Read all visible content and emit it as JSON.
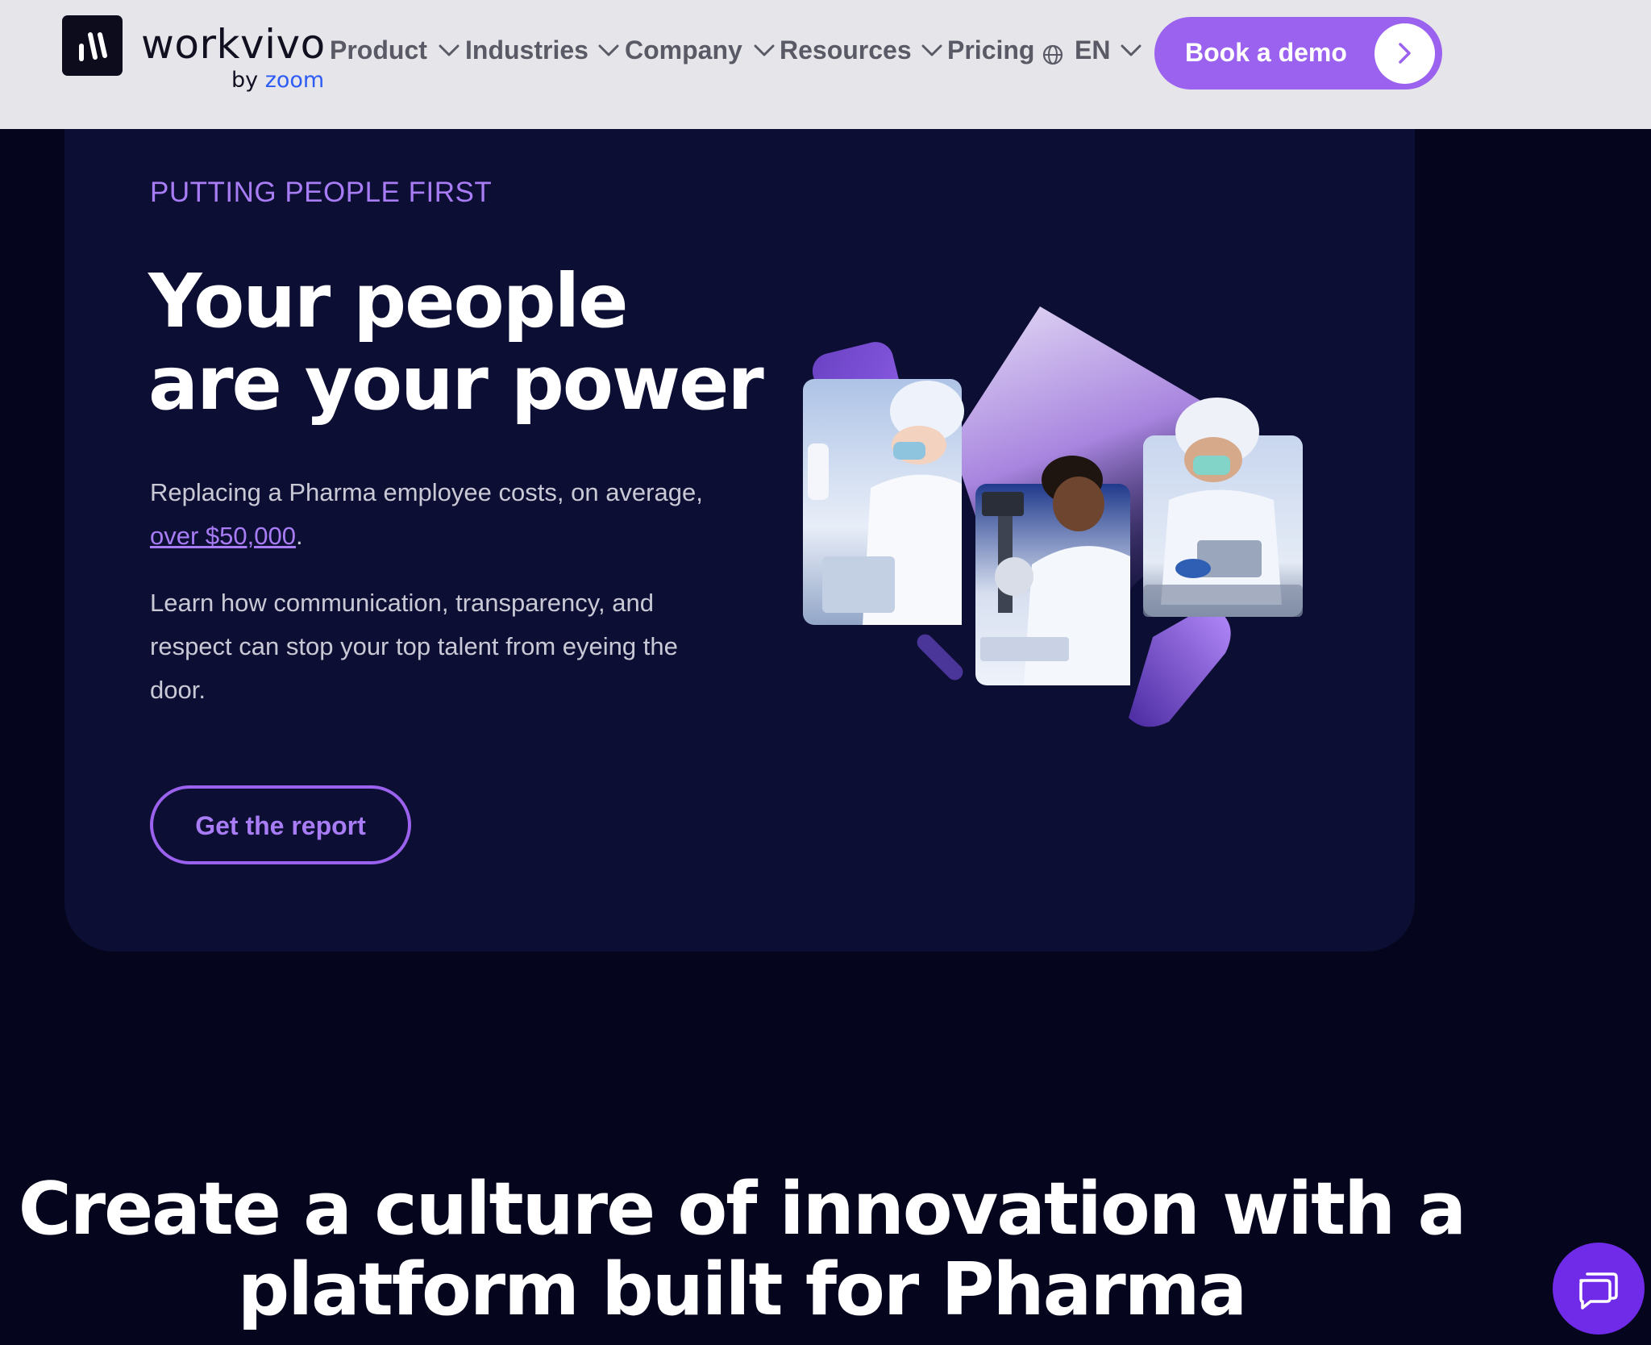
{
  "header": {
    "brand": {
      "name": "workvivo",
      "by": "by",
      "zoom": "zoom"
    },
    "nav": [
      {
        "label": "Product",
        "icon": "chevron-down-icon"
      },
      {
        "label": "Industries",
        "icon": "chevron-down-icon"
      },
      {
        "label": "Company",
        "icon": "chevron-down-icon"
      },
      {
        "label": "Resources",
        "icon": "chevron-down-icon"
      },
      {
        "label": "Pricing",
        "icon": "globe-icon"
      }
    ],
    "language": {
      "label": "EN",
      "icon": "chevron-down-icon"
    },
    "cta": {
      "label": "Book a demo",
      "icon": "chevron-right-icon"
    }
  },
  "hero": {
    "eyebrow": "PUTTING PEOPLE FIRST",
    "headline": "Your people are your power",
    "paragraph1": {
      "before": "Replacing a Pharma employee costs, on average, ",
      "link": "over $50,000",
      "after": "."
    },
    "paragraph2": "Learn how communication, transparency, and respect can stop your top talent from eyeing the door.",
    "button": "Get the report"
  },
  "section": {
    "heading_line1": "Create a culture of innovation with a",
    "heading_line2": "platform built for Pharma"
  },
  "chat": {
    "icon": "chat-bubbles-icon"
  },
  "colors": {
    "accent": "#9a62ee",
    "eyebrow": "#a77cf5",
    "page_bg": "#05061e",
    "card_bg": "#0d0e33",
    "header_bg": "#e6e6ea",
    "zoom_blue": "#2d5cf4"
  }
}
